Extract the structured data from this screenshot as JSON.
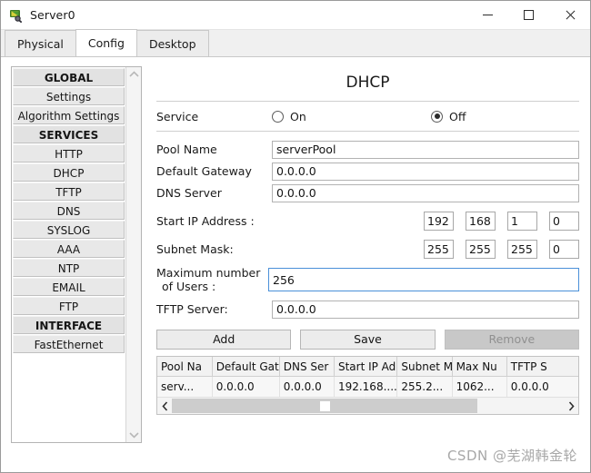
{
  "window": {
    "title": "Server0",
    "icon": "server-device-icon",
    "controls": {
      "minimize": "minimize-icon",
      "maximize": "maximize-icon",
      "close": "close-icon"
    }
  },
  "tabs": [
    {
      "label": "Physical",
      "active": false
    },
    {
      "label": "Config",
      "active": true
    },
    {
      "label": "Desktop",
      "active": false
    }
  ],
  "sidebar": {
    "items": [
      {
        "label": "GLOBAL",
        "type": "group"
      },
      {
        "label": "Settings",
        "type": "item"
      },
      {
        "label": "Algorithm Settings",
        "type": "item"
      },
      {
        "label": "SERVICES",
        "type": "group"
      },
      {
        "label": "HTTP",
        "type": "item"
      },
      {
        "label": "DHCP",
        "type": "item"
      },
      {
        "label": "TFTP",
        "type": "item"
      },
      {
        "label": "DNS",
        "type": "item"
      },
      {
        "label": "SYSLOG",
        "type": "item"
      },
      {
        "label": "AAA",
        "type": "item"
      },
      {
        "label": "NTP",
        "type": "item"
      },
      {
        "label": "EMAIL",
        "type": "item"
      },
      {
        "label": "FTP",
        "type": "item"
      },
      {
        "label": "INTERFACE",
        "type": "group"
      },
      {
        "label": "FastEthernet",
        "type": "item"
      }
    ],
    "scroll_up": "chevron-up-icon",
    "scroll_down": "chevron-down-icon"
  },
  "panel": {
    "title": "DHCP",
    "service": {
      "label": "Service",
      "on_label": "On",
      "off_label": "Off",
      "selected": "Off"
    },
    "fields": {
      "pool_name_label": "Pool Name",
      "pool_name_value": "serverPool",
      "default_gateway_label": "Default Gateway",
      "default_gateway_value": "0.0.0.0",
      "dns_server_label": "DNS Server",
      "dns_server_value": "0.0.0.0",
      "start_ip_label": "Start IP Address :",
      "start_ip_octets": [
        "192",
        "168",
        "1",
        "0"
      ],
      "subnet_mask_label": "Subnet Mask:",
      "subnet_mask_octets": [
        "255",
        "255",
        "255",
        "0"
      ],
      "max_users_label_line1": "Maximum number",
      "max_users_label_line2": "of Users :",
      "max_users_value": "256",
      "tftp_server_label": "TFTP Server:",
      "tftp_server_value": "0.0.0.0"
    },
    "buttons": {
      "add": "Add",
      "save": "Save",
      "remove": "Remove",
      "remove_disabled": true
    },
    "table": {
      "columns": [
        "Pool Na",
        "Default Gat",
        "DNS Ser",
        "Start IP Ad",
        "Subnet M",
        "Max Nu",
        "TFTP S"
      ],
      "rows": [
        [
          "serv...",
          "0.0.0.0",
          "0.0.0.0",
          "192.168....",
          "255.2...",
          "1062...",
          "0.0.0.0"
        ]
      ],
      "hscroll_left": "scroll-left-icon",
      "hscroll_right": "scroll-right-icon"
    }
  },
  "watermark": "CSDN @芜湖韩金轮",
  "colors": {
    "accent_focus": "#4a90d9",
    "window_bg": "#ffffff",
    "chrome_bg": "#f0f0f0",
    "button_bg": "#ececec",
    "disabled_bg": "#c8c8c8"
  }
}
